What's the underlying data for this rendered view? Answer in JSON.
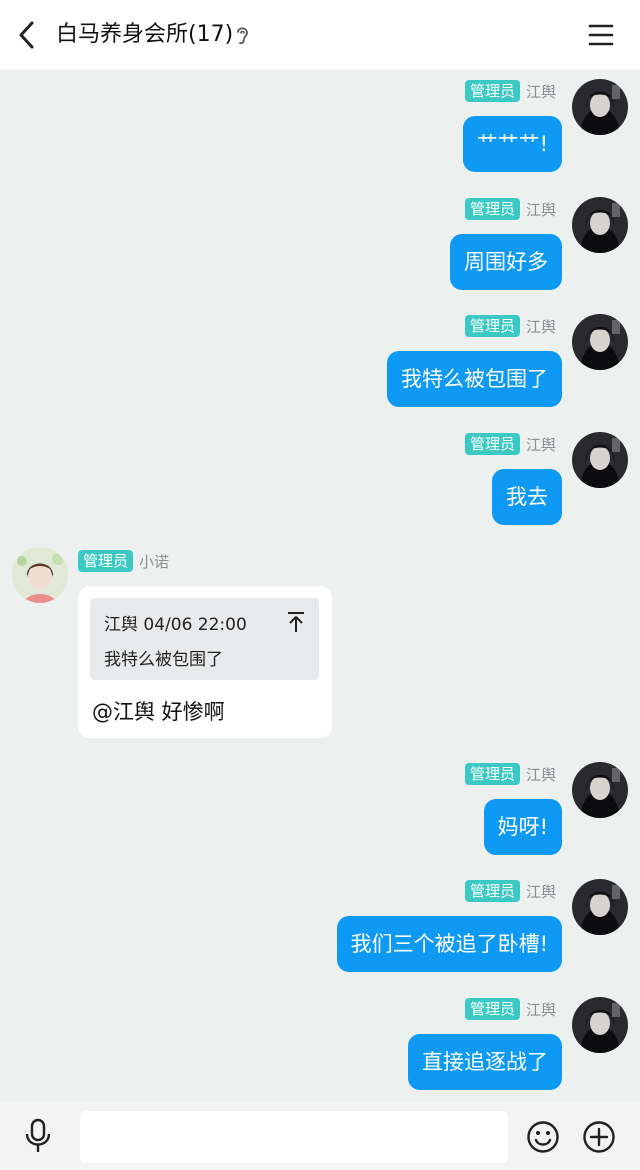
{
  "header": {
    "title": "白马养身会所(17)"
  },
  "messages": [
    {
      "side": "right",
      "badge": "管理员",
      "sender": "江舆",
      "text": "艹艹艹!"
    },
    {
      "side": "right",
      "badge": "管理员",
      "sender": "江舆",
      "text": "周围好多"
    },
    {
      "side": "right",
      "badge": "管理员",
      "sender": "江舆",
      "text": "我特么被包围了"
    },
    {
      "side": "right",
      "badge": "管理员",
      "sender": "江舆",
      "text": "我去"
    },
    {
      "side": "left",
      "badge": "管理员",
      "sender": "小诺",
      "quote": {
        "header": "江舆 04/06 22:00",
        "text": "我特么被包围了"
      },
      "text": "@江舆 好惨啊"
    },
    {
      "side": "right",
      "badge": "管理员",
      "sender": "江舆",
      "text": "妈呀!"
    },
    {
      "side": "right",
      "badge": "管理员",
      "sender": "江舆",
      "text": "我们三个被追了卧槽!"
    },
    {
      "side": "right",
      "badge": "管理员",
      "sender": "江舆",
      "text": "直接追逐战了"
    }
  ],
  "input": {
    "placeholder": ""
  },
  "colors": {
    "accent": "#0d99f4",
    "badge": "#3cc9c3",
    "background": "#ecf0ee"
  }
}
